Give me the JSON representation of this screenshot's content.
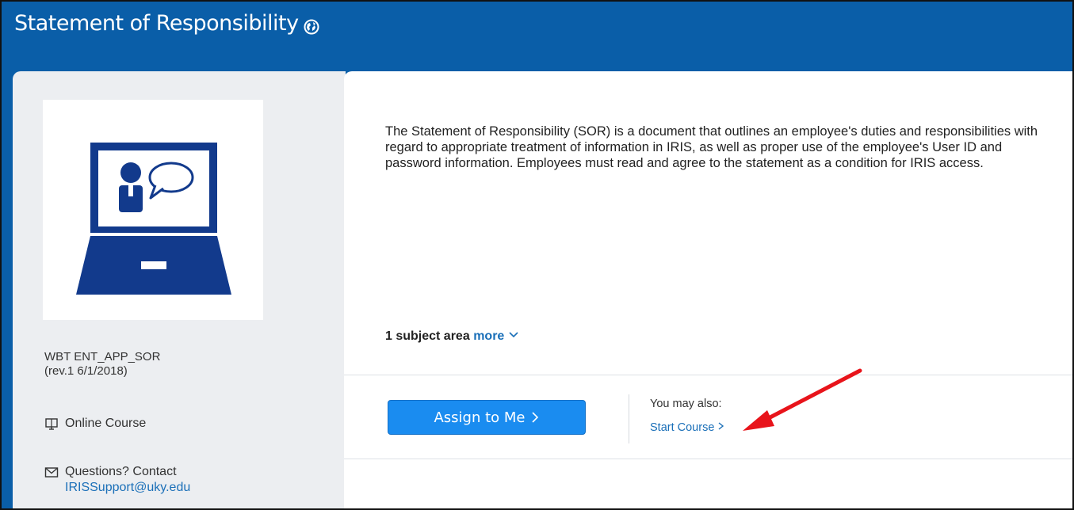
{
  "header": {
    "title": "Statement of Responsibility",
    "icon": "globe-icon",
    "background": "#0a5ea8"
  },
  "sidebar": {
    "course_id_line1": "WBT ENT_APP_SOR",
    "course_id_line2": "(rev.1 6/1/2018)",
    "course_type": "Online Course",
    "course_type_icon": "monitor-icon",
    "contact_label": "Questions? Contact",
    "contact_icon": "envelope-icon",
    "contact_email": "IRISSupport@uky.edu"
  },
  "main": {
    "description": "The Statement of Responsibility (SOR) is a document that outlines an employee's duties and responsibilities with regard to appropriate treatment of information in IRIS, as well as proper use of the employee's User ID and password information.  Employees must read and agree to the statement as a condition for IRIS access.",
    "subject_area": "1 subject area",
    "more_label": "more",
    "assign_button": "Assign to Me",
    "you_may_also": "You may also:",
    "start_course": "Start Course"
  },
  "colors": {
    "accent": "#1a8cf0",
    "link": "#1a6fb8",
    "annotation_arrow": "#e8141b"
  }
}
